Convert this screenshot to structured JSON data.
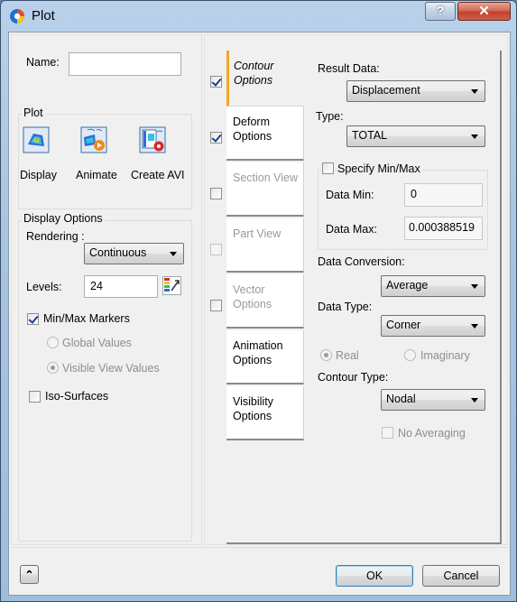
{
  "window": {
    "title": "Plot",
    "help_glyph": "?",
    "close_glyph": "✕"
  },
  "name_field": {
    "label": "Name:",
    "value": ""
  },
  "plot_group": {
    "title": "Plot",
    "buttons": [
      {
        "label": "Display",
        "icon": "display-plot-icon"
      },
      {
        "label": "Animate",
        "icon": "animate-icon"
      },
      {
        "label": "Create AVI",
        "icon": "create-avi-icon"
      }
    ]
  },
  "display_options": {
    "title": "Display Options",
    "rendering_label": "Rendering :",
    "rendering_value": "Continuous",
    "levels_label": "Levels:",
    "levels_value": "24",
    "minmax_label": "Min/Max Markers",
    "minmax_checked": true,
    "global_values_label": "Global Values",
    "visible_view_values_label": "Visible View Values",
    "iso_surfaces_label": "Iso-Surfaces",
    "iso_surfaces_checked": false
  },
  "tabs": [
    {
      "label1": "Contour",
      "label2": "Options",
      "checked": true,
      "state": "active"
    },
    {
      "label1": "Deform",
      "label2": "Options",
      "checked": true,
      "state": "normal"
    },
    {
      "label1": "Section View",
      "label2": "",
      "checked": false,
      "state": "disabled"
    },
    {
      "label1": "Part View",
      "label2": "",
      "checked": false,
      "state": "disabled"
    },
    {
      "label1": "Vector",
      "label2": "Options",
      "checked": false,
      "state": "disabled"
    },
    {
      "label1": "Animation",
      "label2": "Options",
      "checked": null,
      "state": "normal"
    },
    {
      "label1": "Visibility",
      "label2": "Options",
      "checked": null,
      "state": "normal"
    }
  ],
  "contour": {
    "result_data_label": "Result Data:",
    "result_data_value": "Displacement",
    "type_label": "Type:",
    "type_value": "TOTAL",
    "specify_minmax_label": "Specify Min/Max",
    "data_min_label": "Data Min:",
    "data_min_value": "0",
    "data_max_label": "Data Max:",
    "data_max_value": "0.000388519",
    "data_conversion_label": "Data Conversion:",
    "data_conversion_value": "Average",
    "data_type_label": "Data Type:",
    "data_type_value": "Corner",
    "real_label": "Real",
    "imaginary_label": "Imaginary",
    "contour_type_label": "Contour Type:",
    "contour_type_value": "Nodal",
    "no_averaging_label": "No Averaging"
  },
  "footer": {
    "expand_glyph": "⌃",
    "ok_label": "OK",
    "cancel_label": "Cancel"
  }
}
